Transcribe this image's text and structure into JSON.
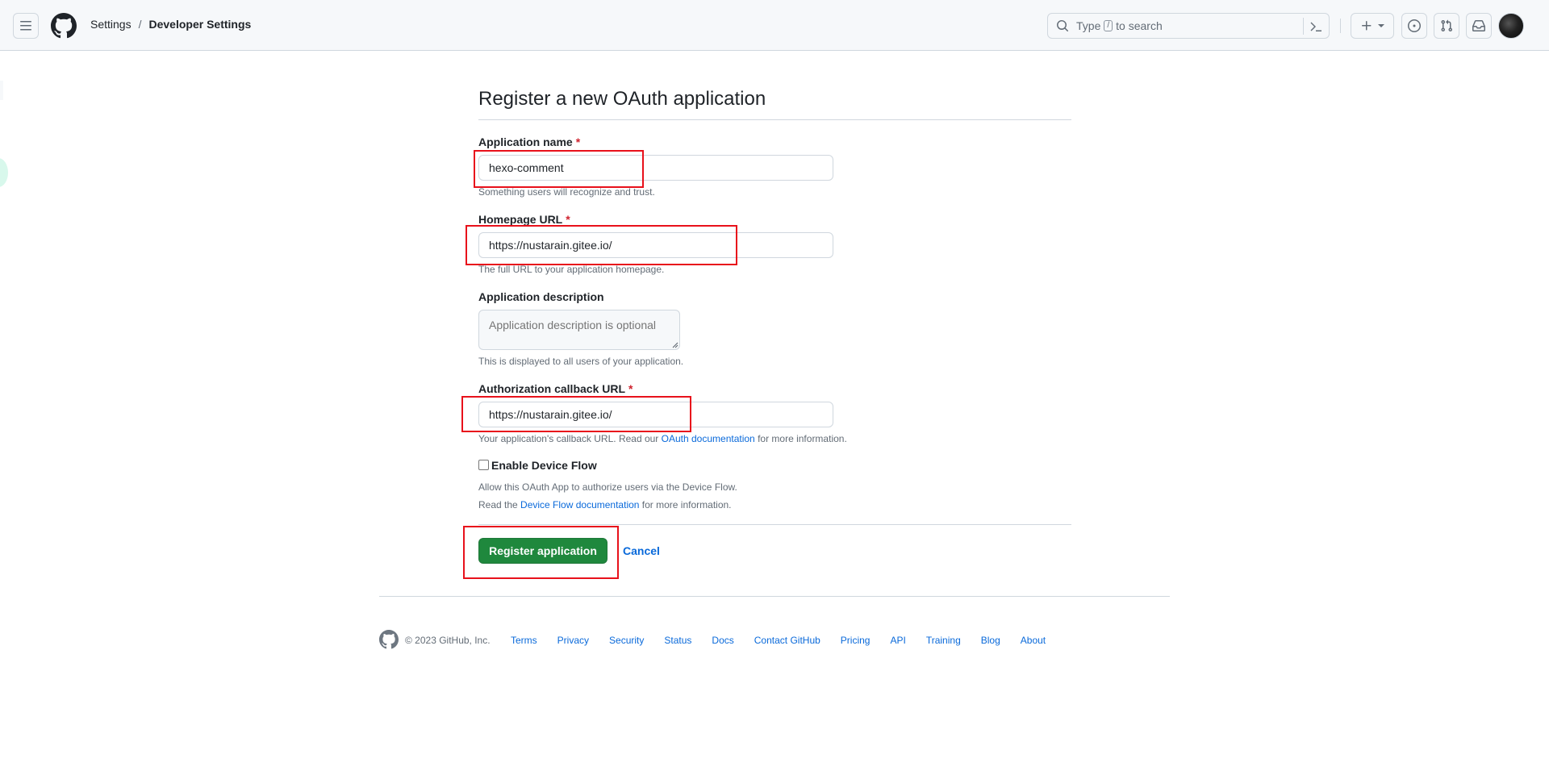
{
  "header": {
    "breadcrumb": {
      "parent": "Settings",
      "separator": "/",
      "current": "Developer Settings"
    },
    "search": {
      "prefix": "Type",
      "key": "/",
      "suffix": "to search"
    }
  },
  "form": {
    "title": "Register a new OAuth application",
    "app_name": {
      "label": "Application name",
      "required_mark": "*",
      "value": "hexo-comment",
      "note": "Something users will recognize and trust."
    },
    "homepage": {
      "label": "Homepage URL",
      "required_mark": "*",
      "value": "https://nustarain.gitee.io/",
      "note": "The full URL to your application homepage."
    },
    "description": {
      "label": "Application description",
      "placeholder": "Application description is optional",
      "note": "This is displayed to all users of your application."
    },
    "callback": {
      "label": "Authorization callback URL",
      "required_mark": "*",
      "value": "https://nustarain.gitee.io/",
      "note_prefix": "Your application's callback URL. Read our",
      "note_link": "OAuth documentation",
      "note_suffix": "for more information."
    },
    "device_flow": {
      "label": "Enable Device Flow",
      "checked": false,
      "note1": "Allow this OAuth App to authorize users via the Device Flow.",
      "note2_prefix": "Read the",
      "note2_link": "Device Flow documentation",
      "note2_suffix": "for more information."
    },
    "register_button": "Register application",
    "cancel_link": "Cancel"
  },
  "footer": {
    "copyright": "© 2023 GitHub, Inc.",
    "links": [
      "Terms",
      "Privacy",
      "Security",
      "Status",
      "Docs",
      "Contact GitHub",
      "Pricing",
      "API",
      "Training",
      "Blog",
      "About"
    ]
  },
  "colors": {
    "primary_button": "#1f883d",
    "link": "#0969da",
    "required": "#cf222e",
    "highlight_box": "#e8111b"
  }
}
